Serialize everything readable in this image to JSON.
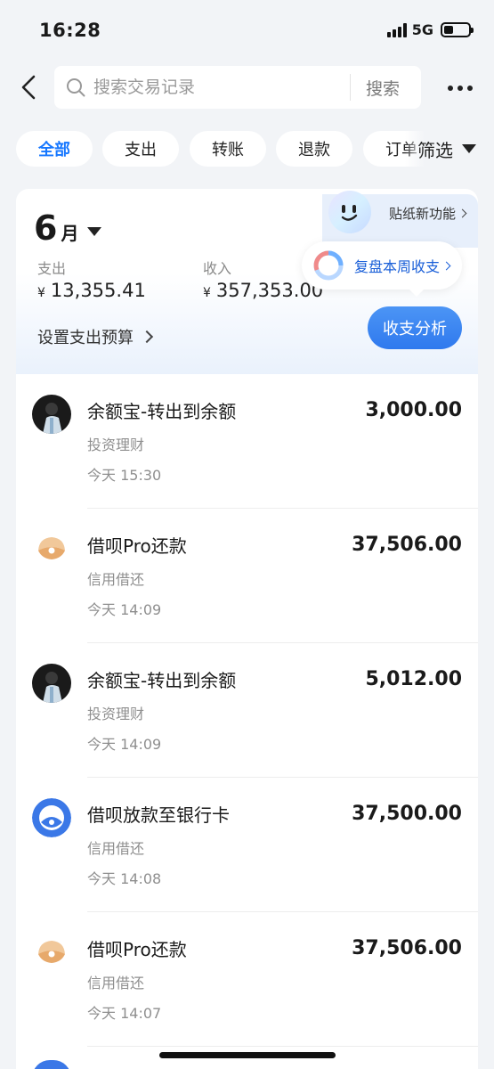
{
  "status_bar": {
    "time": "16:28",
    "network": "5G",
    "battery_level": 0.4
  },
  "header": {
    "back_icon": "chevron-left-icon",
    "search_placeholder": "搜索交易记录",
    "search_button": "搜索",
    "more_icon": "more-dots-icon"
  },
  "filters": {
    "chips": [
      "全部",
      "支出",
      "转账",
      "退款",
      "订单"
    ],
    "active_index": 0,
    "filter_label": "筛选"
  },
  "summary": {
    "month_number": "6",
    "month_suffix": "月",
    "expense_label": "支出",
    "expense_currency": "¥",
    "expense_value": "13,355.41",
    "income_label": "收入",
    "income_currency": "¥",
    "income_value": "357,353.00",
    "budget_link": "设置支出预算",
    "sticker_feature": "贴纸新功能",
    "weekly_review": "复盘本周收支",
    "analysis_button": "收支分析"
  },
  "transactions": [
    {
      "title": "余额宝-转出到余额",
      "category": "投资理财",
      "time": "今天 15:30",
      "amount": "3,000.00",
      "icon": "avatar-photo-icon"
    },
    {
      "title": "借呗Pro还款",
      "category": "信用借还",
      "time": "今天 14:09",
      "amount": "37,506.00",
      "icon": "jiebei-shell-icon"
    },
    {
      "title": "余额宝-转出到余额",
      "category": "投资理财",
      "time": "今天 14:09",
      "amount": "5,012.00",
      "icon": "avatar-photo-icon"
    },
    {
      "title": "借呗放款至银行卡",
      "category": "信用借还",
      "time": "今天 14:08",
      "amount": "37,500.00",
      "icon": "jiebei-blue-icon"
    },
    {
      "title": "借呗Pro还款",
      "category": "信用借还",
      "time": "今天 14:07",
      "amount": "37,506.00",
      "icon": "jiebei-shell-icon"
    }
  ],
  "colors": {
    "accent": "#1677ff",
    "background": "#f2f4f7",
    "button_blue": "#2f79ee"
  }
}
